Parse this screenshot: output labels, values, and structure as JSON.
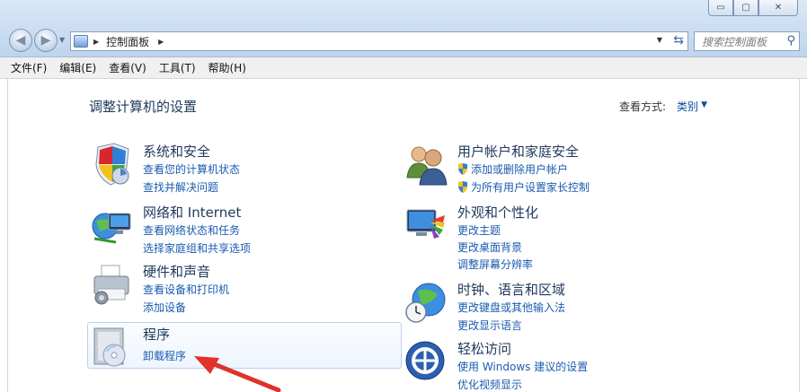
{
  "window": {
    "controls": {
      "minimize": "▭",
      "maximize": "▢",
      "close": "✕"
    }
  },
  "address": {
    "path": "控制面板"
  },
  "search": {
    "placeholder": "搜索控制面板"
  },
  "menu": [
    "文件(F)",
    "编辑(E)",
    "查看(V)",
    "工具(T)",
    "帮助(H)"
  ],
  "page": {
    "title": "调整计算机的设置",
    "view_by_label": "查看方式:",
    "view_by_value": "类别"
  },
  "categories": {
    "security": {
      "title": "系统和安全",
      "links": [
        "查看您的计算机状态",
        "查找并解决问题"
      ]
    },
    "network": {
      "title": "网络和 Internet",
      "links": [
        "查看网络状态和任务",
        "选择家庭组和共享选项"
      ]
    },
    "hardware": {
      "title": "硬件和声音",
      "links": [
        "查看设备和打印机",
        "添加设备"
      ]
    },
    "programs": {
      "title": "程序",
      "links": [
        "卸载程序"
      ]
    },
    "accounts": {
      "title": "用户帐户和家庭安全",
      "links": [
        "添加或删除用户帐户",
        "为所有用户设置家长控制"
      ]
    },
    "appearance": {
      "title": "外观和个性化",
      "links": [
        "更改主题",
        "更改桌面背景",
        "调整屏幕分辨率"
      ]
    },
    "clock": {
      "title": "时钟、语言和区域",
      "links": [
        "更改键盘或其他输入法",
        "更改显示语言"
      ]
    },
    "ease": {
      "title": "轻松访问",
      "links": [
        "使用 Windows 建议的设置",
        "优化视频显示"
      ]
    }
  },
  "colors": {
    "link": "#1a5bb0",
    "heading": "#1e395b",
    "annotation_arrow": "#e0312a"
  }
}
